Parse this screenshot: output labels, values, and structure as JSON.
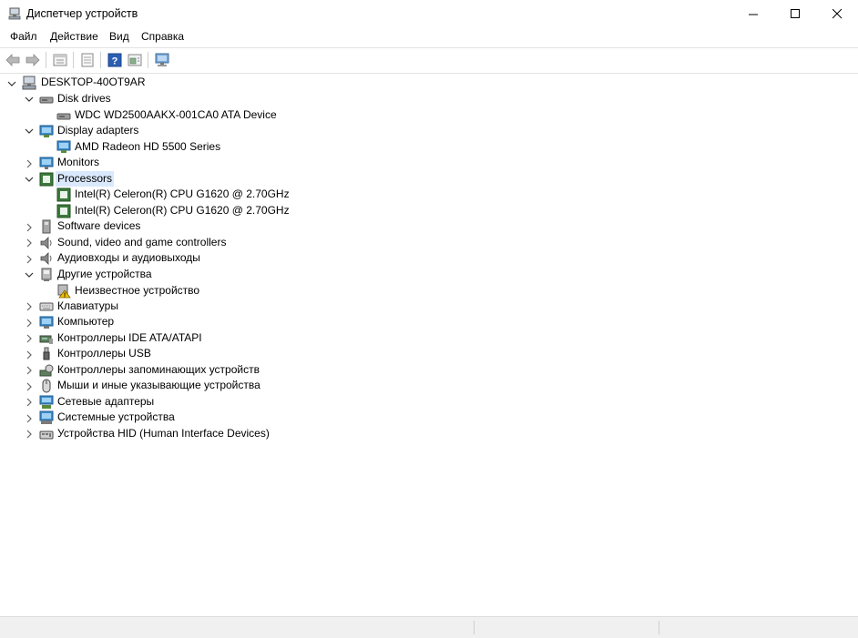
{
  "window": {
    "title": "Диспетчер устройств"
  },
  "menu": [
    {
      "label": "Файл"
    },
    {
      "label": "Действие"
    },
    {
      "label": "Вид"
    },
    {
      "label": "Справка"
    }
  ],
  "tree": {
    "root": "DESKTOP-40OT9AR",
    "disk_drives": {
      "label": "Disk drives",
      "children": [
        "WDC WD2500AAKX-001CA0 ATA Device"
      ]
    },
    "display_adapters": {
      "label": "Display adapters",
      "children": [
        "AMD Radeon HD 5500 Series"
      ]
    },
    "monitors": {
      "label": "Monitors"
    },
    "processors": {
      "label": "Processors",
      "children": [
        "Intel(R) Celeron(R) CPU G1620 @ 2.70GHz",
        "Intel(R) Celeron(R) CPU G1620 @ 2.70GHz"
      ]
    },
    "software_devices": {
      "label": "Software devices"
    },
    "sound": {
      "label": "Sound, video and game controllers"
    },
    "audio_io": {
      "label": "Аудиовходы и аудиовыходы"
    },
    "other_devices": {
      "label": "Другие устройства",
      "children": [
        "Неизвестное устройство"
      ]
    },
    "keyboards": {
      "label": "Клавиатуры"
    },
    "computer": {
      "label": "Компьютер"
    },
    "ide": {
      "label": "Контроллеры IDE ATA/ATAPI"
    },
    "usb": {
      "label": "Контроллеры USB"
    },
    "storage": {
      "label": "Контроллеры запоминающих устройств"
    },
    "mice": {
      "label": "Мыши и иные указывающие устройства"
    },
    "network": {
      "label": "Сетевые адаптеры"
    },
    "system": {
      "label": "Системные устройства"
    },
    "hid": {
      "label": "Устройства HID (Human Interface Devices)"
    }
  },
  "icons": {
    "back": "arrow-left-icon",
    "forward": "arrow-right-icon",
    "properties": "properties-icon",
    "show_hidden": "list-view-icon",
    "help": "help-icon",
    "update": "update-driver-icon",
    "scan": "scan-hardware-icon"
  },
  "colors": {
    "selection": "#d9e8fb",
    "processor_green": "#3b7a3b",
    "help_blue": "#2b5fb4",
    "warning": "#f2c200"
  }
}
